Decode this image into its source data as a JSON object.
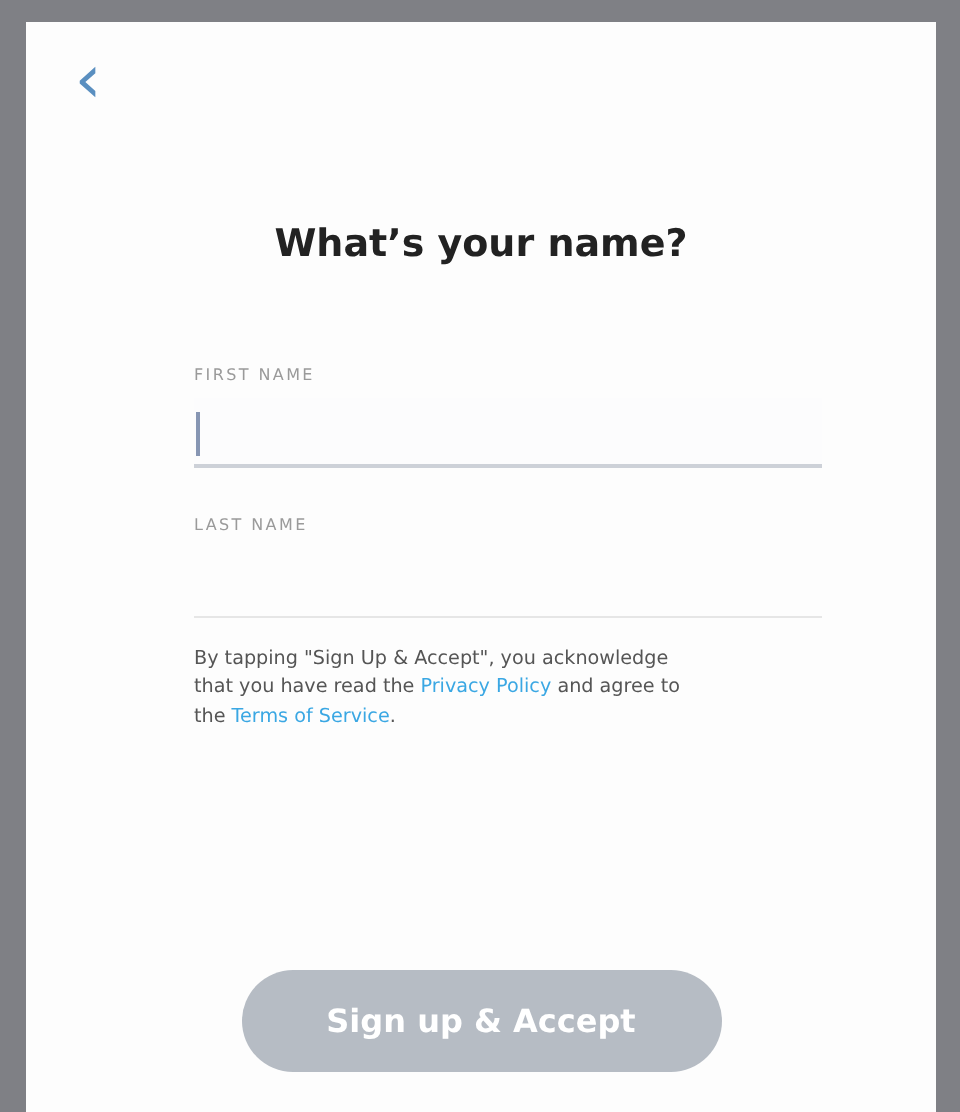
{
  "back_button": {
    "label": "‹"
  },
  "title": "What’s your name?",
  "fields": [
    {
      "label": "FIRST NAME",
      "focused": true
    },
    {
      "label": "LAST NAME",
      "focused": false
    }
  ],
  "notice": [
    {
      "kind": "text",
      "text": "By tapping \"Sign Up & Accept\", you acknowledge that you have read the "
    },
    {
      "kind": "link",
      "text": "Privacy Policy"
    },
    {
      "kind": "text",
      "text": " and agree to the "
    },
    {
      "kind": "link",
      "text": "Terms of Service"
    },
    {
      "kind": "text",
      "text": "."
    }
  ],
  "submit_button": {
    "label": "Sign up & Accept",
    "disabled": true
  }
}
